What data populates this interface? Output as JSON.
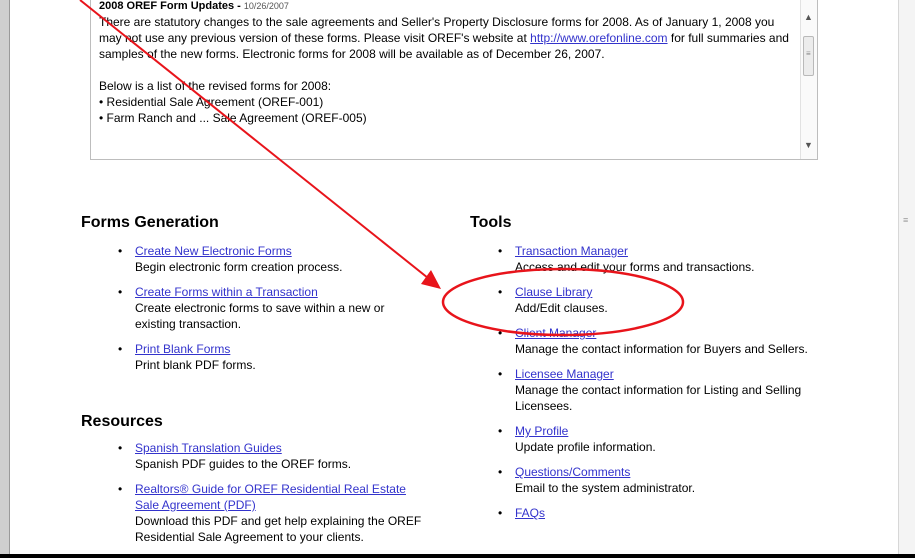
{
  "news": {
    "title": "2008 OREF Form Updates",
    "separator": " - ",
    "date": "10/26/2007",
    "paragraph1_before_link": "There are statutory changes to the sale agreements and Seller's Property Disclosure forms for 2008. As of January 1, 2008 you may not use any previous version of these forms. Please visit OREF's website at ",
    "link_text": "http://www.orefonline.com",
    "paragraph1_after_link": " for full summaries and samples of the new forms. Electronic forms for 2008 will be available as of December 26, 2007.",
    "paragraph2": "Below is a list of the revised forms for 2008:",
    "bullet1": "• Residential Sale Agreement (OREF-001)",
    "bullet2_partial": "• Farm Ranch and ... Sale Agreement (OREF-005)"
  },
  "forms_generation": {
    "heading": "Forms Generation",
    "items": [
      {
        "link": "Create New Electronic Forms",
        "desc": "Begin electronic form creation process."
      },
      {
        "link": "Create Forms within a Transaction",
        "desc": "Create electronic forms to save within a new or existing transaction."
      },
      {
        "link": "Print Blank Forms",
        "desc": "Print blank PDF forms."
      }
    ]
  },
  "resources": {
    "heading": "Resources",
    "items": [
      {
        "link": "Spanish Translation Guides",
        "desc": "Spanish PDF guides to the OREF forms."
      },
      {
        "link": "Realtors® Guide for OREF Residential Real Estate Sale Agreement (PDF)",
        "desc": "Download this PDF and get help explaining the OREF Residential Sale Agreement to your clients."
      }
    ]
  },
  "tools": {
    "heading": "Tools",
    "items": [
      {
        "link": "Transaction Manager",
        "desc": "Access and edit your forms and transactions."
      },
      {
        "link": "Clause Library",
        "desc": "Add/Edit clauses."
      },
      {
        "link": "Client Manager",
        "desc": "Manage the contact information for Buyers and Sellers."
      },
      {
        "link": "Licensee Manager",
        "desc": "Manage the contact information for Listing and Selling Licensees."
      },
      {
        "link": "My Profile",
        "desc": "Update profile information."
      },
      {
        "link": "Questions/Comments",
        "desc": "Email to the system administrator."
      },
      {
        "link": "FAQs",
        "desc": ""
      }
    ]
  },
  "bullet_glyph": "•",
  "annotation_color": "#e8141b"
}
